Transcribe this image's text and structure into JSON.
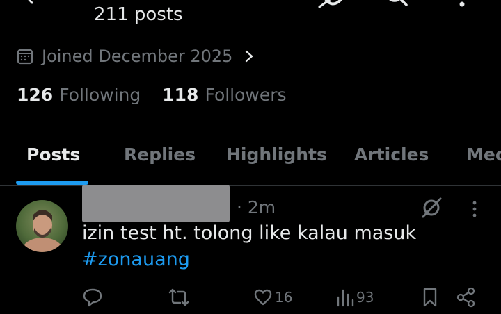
{
  "header": {
    "posts_count": "211 posts"
  },
  "profile": {
    "joined": "Joined December 2025",
    "following_count": "126",
    "following_label": "Following",
    "followers_count": "118",
    "followers_label": "Followers"
  },
  "tabs": [
    {
      "label": "Posts",
      "active": true
    },
    {
      "label": "Replies"
    },
    {
      "label": "Highlights"
    },
    {
      "label": "Articles"
    },
    {
      "label": "Media"
    }
  ],
  "post": {
    "time": "· 2m",
    "text": "izin test ht. tolong like kalau masuk",
    "hashtag": "#zonauang",
    "likes": "16",
    "views": "93"
  },
  "icons": [
    "back-arrow-icon",
    "grok-icon",
    "search-icon",
    "more-icon",
    "calendar-icon",
    "chevron-right-icon",
    "reply-icon",
    "repost-icon",
    "like-icon",
    "views-icon",
    "bookmark-icon",
    "share-icon"
  ],
  "colors": {
    "background": "#000000",
    "text": "#e7e9ea",
    "muted": "#71767b",
    "accent": "#1d9bf0",
    "divider": "#2f3336"
  }
}
